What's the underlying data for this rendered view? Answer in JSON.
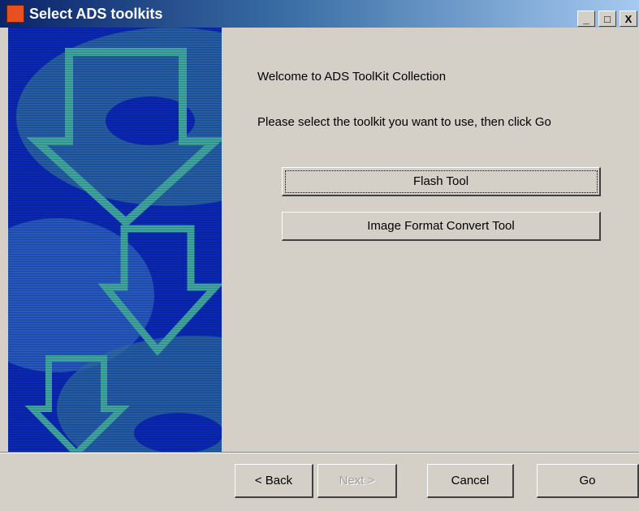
{
  "window": {
    "title": "Select ADS toolkits",
    "controls": {
      "minimize": "_",
      "maximize": "□",
      "close": "X"
    }
  },
  "content": {
    "welcome": "Welcome to ADS ToolKit Collection",
    "instruction": "Please select the toolkit you want to use, then click Go"
  },
  "toolkits": [
    {
      "label": "Flash Tool"
    },
    {
      "label": "Image Format Convert Tool"
    }
  ],
  "nav": {
    "back": "< Back",
    "next": "Next >",
    "cancel": "Cancel",
    "go": "Go"
  },
  "colors": {
    "panel_blue": "#0a28b4",
    "arrow_teal": "#3fa5a0",
    "disk_teal": "#2e6fa0"
  }
}
